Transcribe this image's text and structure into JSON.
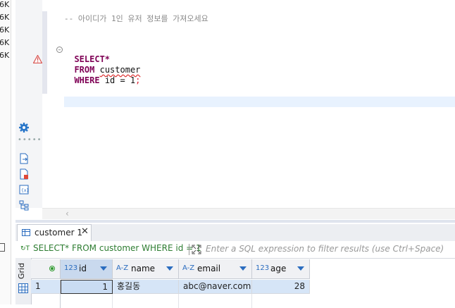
{
  "left_strip": {
    "sizes": [
      "6K",
      "6K",
      "6K",
      "6K",
      "6K"
    ]
  },
  "editor": {
    "comment": "-- 아이디가 1인 유저 정보를 가져오세요",
    "line1_kw": "SELECT*",
    "line2_kw": "FROM",
    "line2_ident": "customer",
    "line3_kw": "WHERE",
    "line3_rest": "id = 1",
    "line3_semicolon": ";"
  },
  "results": {
    "tab_label": "customer 1",
    "filter_query": "SELECT* FROM customer WHERE id = 1",
    "filter_placeholder": "Enter a SQL expression to filter results (use Ctrl+Space)",
    "view_tab_label": "Grid",
    "columns": [
      {
        "type_icon": "123",
        "name": "id"
      },
      {
        "type_icon": "A-Z",
        "name": "name"
      },
      {
        "type_icon": "A-Z",
        "name": "email"
      },
      {
        "type_icon": "123",
        "name": "age"
      }
    ],
    "rows": [
      {
        "rownum": "1",
        "id": "1",
        "name": "홍길동",
        "email": "abc@naver.com",
        "age": "28"
      }
    ]
  },
  "colors": {
    "keyword": "#7f0055",
    "selection": "#d6e5f7",
    "filter_text": "#2e7d32",
    "accent_blue": "#2a6cbf"
  }
}
